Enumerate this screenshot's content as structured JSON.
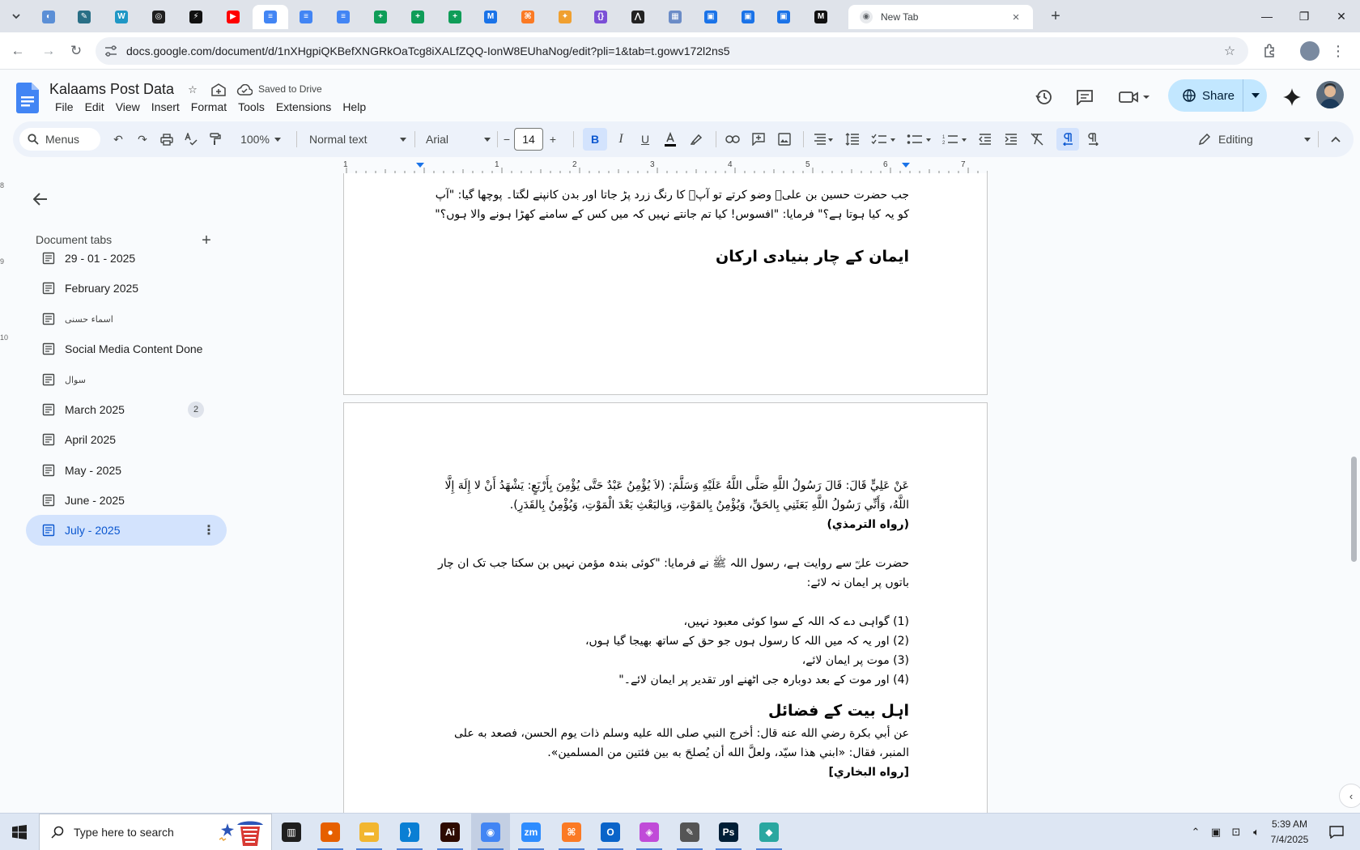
{
  "browser": {
    "tab_favicons": [
      {
        "name": "app-tab-1",
        "color": "#5b8fd6",
        "glyph": "◐"
      },
      {
        "name": "pen-tab",
        "color": "#2a6f86",
        "glyph": "✎"
      },
      {
        "name": "wordpress-tab",
        "color": "#1f97c5",
        "glyph": "W"
      },
      {
        "name": "openai-tab",
        "color": "#1f1f1f",
        "glyph": "◎"
      },
      {
        "name": "lightning-tab",
        "color": "#111111",
        "glyph": "⚡"
      },
      {
        "name": "youtube-tab",
        "color": "#ff0000",
        "glyph": "▶"
      },
      {
        "name": "docs-tab-active",
        "color": "#4285f4",
        "glyph": "≡"
      },
      {
        "name": "docs-tab-2",
        "color": "#4285f4",
        "glyph": "≡"
      },
      {
        "name": "docs-tab-3",
        "color": "#4285f4",
        "glyph": "≡"
      },
      {
        "name": "sheets-tab-1",
        "color": "#0f9d58",
        "glyph": "+"
      },
      {
        "name": "sheets-tab-2",
        "color": "#0f9d58",
        "glyph": "+"
      },
      {
        "name": "sheets-tab-3",
        "color": "#0f9d58",
        "glyph": "+"
      },
      {
        "name": "sheets-tab-4",
        "color": "#1a73e8",
        "glyph": "M"
      },
      {
        "name": "xampp-tab",
        "color": "#fb7a24",
        "glyph": "⌘"
      },
      {
        "name": "bird-tab",
        "color": "#f0a030",
        "glyph": "✦"
      },
      {
        "name": "code-tab",
        "color": "#7b4fd6",
        "glyph": "{}"
      },
      {
        "name": "dark-tab",
        "color": "#222222",
        "glyph": "⋀"
      },
      {
        "name": "grid-tab",
        "color": "#6b8cc7",
        "glyph": "▦"
      },
      {
        "name": "forms-tab-1",
        "color": "#1a73e8",
        "glyph": "▣"
      },
      {
        "name": "forms-tab-2",
        "color": "#1a73e8",
        "glyph": "▣"
      },
      {
        "name": "forms-tab-3",
        "color": "#1a73e8",
        "glyph": "▣"
      },
      {
        "name": "m-tab",
        "color": "#111111",
        "glyph": "M"
      }
    ],
    "new_tab_label": "New Tab",
    "url": "docs.google.com/document/d/1nXHgpiQKBefXNGRkOaTcg8iXALfZQQ-IonW8EUhaNog/edit?pli=1&tab=t.gowv172l2ns5"
  },
  "docs": {
    "title": "Kalaams Post Data",
    "save_status": "Saved to Drive",
    "menu": [
      "File",
      "Edit",
      "View",
      "Insert",
      "Format",
      "Tools",
      "Extensions",
      "Help"
    ],
    "share_label": "Share",
    "accent": "#0b57d0",
    "share_bg": "#c2e7ff"
  },
  "toolbar": {
    "menus_label": "Menus",
    "zoom": "100%",
    "style": "Normal text",
    "font": "Arial",
    "font_size": "14",
    "bold_label": "B",
    "editing_label": "Editing"
  },
  "ruler": [
    "1",
    "1",
    "2",
    "3",
    "4",
    "5",
    "6",
    "7"
  ],
  "vruler": [
    "8",
    "9",
    "10"
  ],
  "sidebar": {
    "heading": "Document tabs",
    "items": [
      {
        "label": "29 - 01 - 2025"
      },
      {
        "label": "February 2025"
      },
      {
        "label": "اسماء حسنی"
      },
      {
        "label": "Social Media Content Done"
      },
      {
        "label": "سوال"
      },
      {
        "label": "March 2025",
        "badge": "2"
      },
      {
        "label": "April 2025"
      },
      {
        "label": "May - 2025"
      },
      {
        "label": "June - 2025"
      },
      {
        "label": "July - 2025",
        "selected": true
      }
    ]
  },
  "page1": {
    "p1": "جب حضرت حسین بن علیؓ وضو کرتے تو آپؓ کا رنگ زرد پڑ جاتا اور بدن کانپنے لگتا۔ پوچھا گیا: \"آپ کو یہ کیا ہوتا ہے؟\" فرمایا: \"افسوس! کیا تم جانتے نہیں کہ میں کس کے سامنے کھڑا ہونے والا ہوں؟\"",
    "heading": "ایمان کے چار بنیادی ارکان"
  },
  "page2": {
    "arabic": "عَنْ عَلِيٍّ قَالَ: قَالَ رَسُولُ اللَّهِ صَلَّى اللَّهُ عَلَيْهِ وَسَلَّمَ: (لاَ يُؤْمِنُ عَبْدٌ حَتَّى يُؤْمِنَ بِأَرْبَعٍ: يَشْهَدُ أَنْ لا إِلَهَ إِلَّا اللَّهُ، وَأَنِّي رَسُولُ اللَّهِ بَعَثَنِي بِالحَقِّ، وَيُؤْمِنُ بِالمَوْتِ، وَبِالبَعْثِ بَعْدَ الْمَوْتِ، وَيُؤْمِنُ بِالقَدَرِ).",
    "ref1": "(رواه الترمذي)",
    "urdu": "حضرت علیؓ سے روایت ہے، رسول اللہ ﷺ نے فرمایا: \"کوئی بندہ مؤمن نہیں بن سکتا جب تک ان چار باتوں پر ایمان نہ لائے:",
    "list": [
      "(1) گواہی دے کہ اللہ کے سوا کوئی معبود نہیں،",
      "(2) اور یہ کہ میں اللہ کا رسول ہوں جو حق کے ساتھ بھیجا گیا ہوں،",
      "(3) موت پر ایمان لائے،",
      "(4) اور موت کے بعد دوبارہ جی اٹھنے اور تقدیر پر ایمان لائے۔\""
    ],
    "heading2": "اہل بیت کے فضائل",
    "arabic2": "عن أبي بكرة رضي الله عنه قال: أخرج النبي صلى الله عليه وسلم ذات يوم الحسن، فصعد به على المنبر، فقال: «ابني هذا سيّد، ولعلَّ الله أن يُصلحَ به بين فئتين من المسلمين».",
    "ref2": "[رواه البخاري]"
  },
  "taskbar": {
    "search_placeholder": "Type here to search",
    "apps": [
      {
        "name": "task-view",
        "color": "#1f1f1f",
        "glyph": "▥"
      },
      {
        "name": "firefox",
        "color": "#e66000",
        "glyph": "●"
      },
      {
        "name": "file-explorer",
        "color": "#f2b630",
        "glyph": "▬"
      },
      {
        "name": "vscode",
        "color": "#0a7fd4",
        "glyph": "⟩"
      },
      {
        "name": "illustrator",
        "color": "#2d0a00",
        "glyph": "Ai"
      },
      {
        "name": "chrome",
        "color": "#4285f4",
        "glyph": "◉"
      },
      {
        "name": "zoom",
        "color": "#2d8cff",
        "glyph": "zm"
      },
      {
        "name": "xampp",
        "color": "#fb7a24",
        "glyph": "⌘"
      },
      {
        "name": "outlook",
        "color": "#0a64c9",
        "glyph": "O"
      },
      {
        "name": "photos",
        "color": "#c04bd8",
        "glyph": "◈"
      },
      {
        "name": "pen-tool",
        "color": "#555555",
        "glyph": "✎"
      },
      {
        "name": "photoshop",
        "color": "#001e36",
        "glyph": "Ps"
      },
      {
        "name": "app-diamond",
        "color": "#2aa7a0",
        "glyph": "◆"
      }
    ],
    "time": "5:39 AM",
    "date": "7/4/2025"
  }
}
